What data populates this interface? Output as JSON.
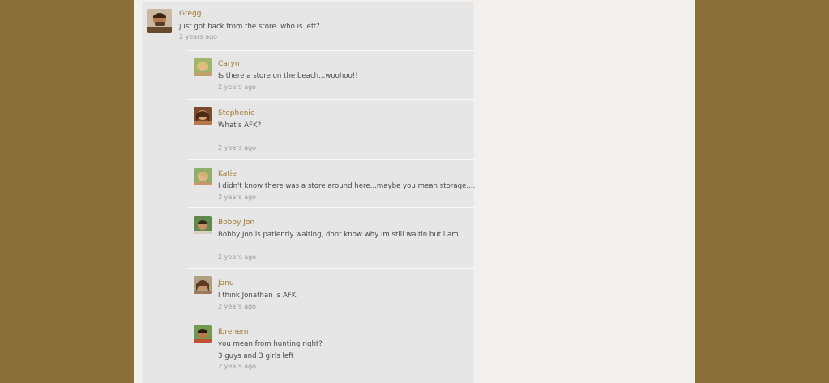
{
  "post": {
    "author": "Gregg",
    "text": "just got back from the store.  who is left?",
    "time": "2 years ago",
    "avatar_icon": "gregg-avatar"
  },
  "replies": [
    {
      "author": "Caryn",
      "lines": [
        "Is there a store on the beach...woohoo!!"
      ],
      "time": "2 years ago",
      "avatar_icon": "caryn-avatar"
    },
    {
      "author": "Stephenie",
      "lines": [
        "What's AFK?"
      ],
      "time": "2 years ago",
      "avatar_icon": "stephenie-avatar"
    },
    {
      "author": "Katie",
      "lines": [
        "I didn't know there was a store around here...maybe you mean storage...."
      ],
      "time": "2 years ago",
      "avatar_icon": "katie-avatar"
    },
    {
      "author": "Bobby Jon",
      "lines": [
        "Bobby Jon is patiently waiting, dont know  why im still waitin but i am."
      ],
      "time": "2 years ago",
      "avatar_icon": "bobby-jon-avatar"
    },
    {
      "author": "Janu",
      "lines": [
        "I think Jonathan is AFK"
      ],
      "time": "2 years ago",
      "avatar_icon": "janu-avatar"
    },
    {
      "author": "Ibrehem",
      "lines": [
        "you mean from hunting right?",
        "3 guys and 3 girls left"
      ],
      "time": "2 years ago",
      "avatar_icon": "ibrehem-avatar"
    }
  ]
}
